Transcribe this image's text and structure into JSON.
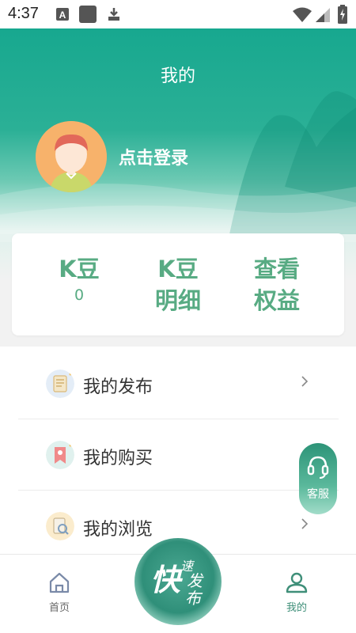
{
  "status_bar": {
    "time": "4:37"
  },
  "header": {
    "title": "我的"
  },
  "profile": {
    "login_label": "点击登录"
  },
  "stats_card": {
    "kbean_label": "K豆",
    "kbean_value": "0",
    "detail_line1": "K豆",
    "detail_line2": "明细",
    "benefits_line1": "查看",
    "benefits_line2": "权益"
  },
  "menu": {
    "items": [
      {
        "label": "我的发布",
        "icon": "document-icon"
      },
      {
        "label": "我的购买",
        "icon": "bookmark-icon"
      },
      {
        "label": "我的浏览",
        "icon": "browse-icon"
      }
    ]
  },
  "floating": {
    "service_label": "客服"
  },
  "tabbar": {
    "home_label": "首页",
    "publish_main": "快",
    "publish_s1": "速",
    "publish_s2": "发",
    "publish_s3": "布",
    "mine_label": "我的"
  },
  "colors": {
    "accent": "#58ab83",
    "hero": "#17a88f",
    "active_tab": "#3f8f79",
    "inactive_tab": "#666666"
  }
}
